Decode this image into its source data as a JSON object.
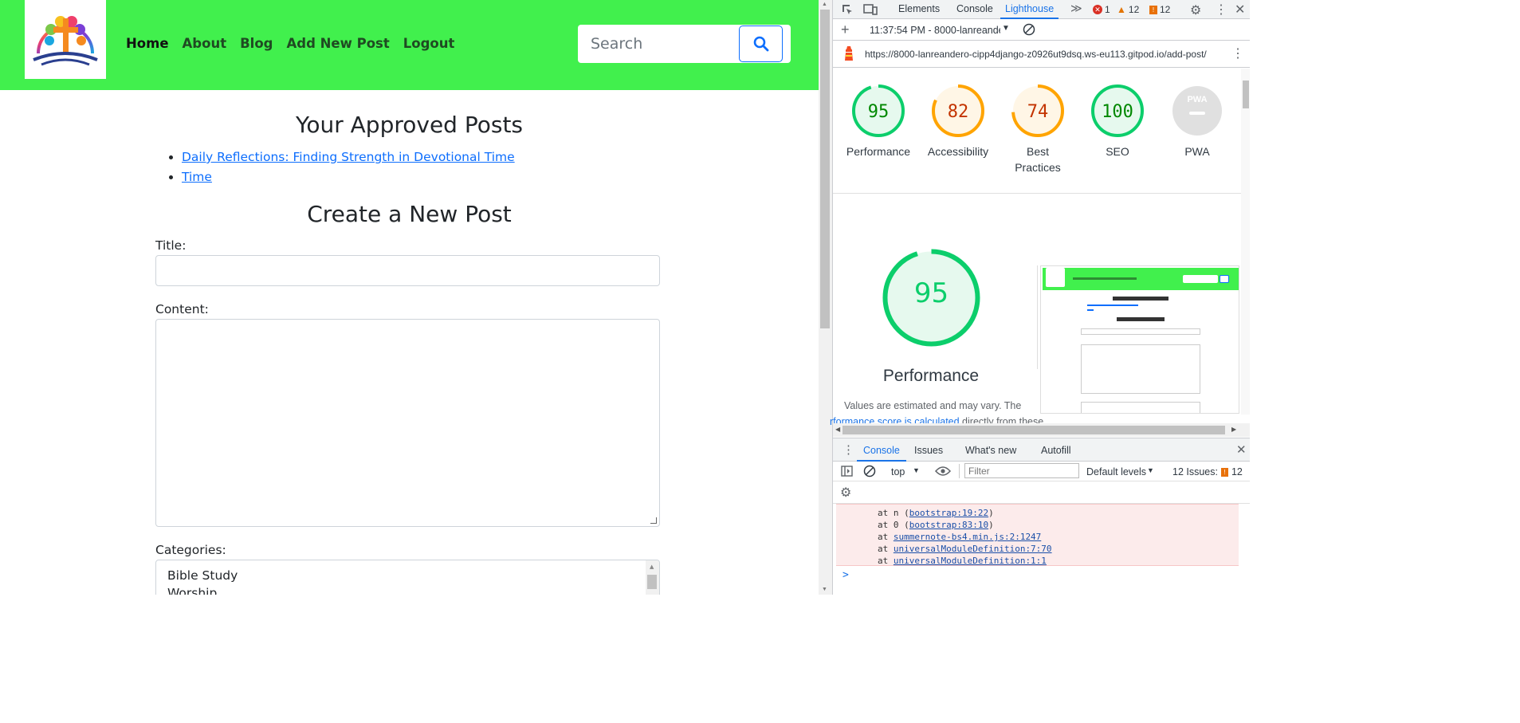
{
  "page": {
    "nav": {
      "links": [
        "Home",
        "About",
        "Blog",
        "Add New Post",
        "Logout"
      ],
      "search_placeholder": "Search"
    },
    "approved": {
      "heading": "Your Approved Posts",
      "posts": [
        "Daily Reflections: Finding Strength in Devotional Time",
        "Time"
      ]
    },
    "form": {
      "heading": "Create a New Post",
      "title_label": "Title:",
      "content_label": "Content:",
      "categories_label": "Categories:",
      "categories": [
        "Bible Study",
        "Worship"
      ]
    }
  },
  "devtools": {
    "tabs": [
      "Elements",
      "Console",
      "Lighthouse"
    ],
    "active_tab": "Lighthouse",
    "badges": {
      "errors": "1",
      "warnings": "12",
      "issues": "12"
    },
    "report_time": "11:37:54 PM - 8000-lanreande",
    "url": "https://8000-lanreandero-cipp4django-z0926ut9dsq.ws-eu113.gitpod.io/add-post/",
    "scores": [
      {
        "label": "Performance",
        "value": 95,
        "color": "#0cce6b",
        "bg": "#e6f9ee",
        "text": "#008800"
      },
      {
        "label": "Accessibility",
        "value": 82,
        "color": "#ffa400",
        "bg": "#fff6e6",
        "text": "#c33300"
      },
      {
        "label": "Best Practices",
        "value": 74,
        "color": "#ffa400",
        "bg": "#fff6e6",
        "text": "#c33300"
      },
      {
        "label": "SEO",
        "value": 100,
        "color": "#0cce6b",
        "bg": "#e6f9ee",
        "text": "#008800"
      },
      {
        "label": "PWA",
        "value": "PWA",
        "color": "#dadada",
        "bg": "#e0e0e0",
        "text": "#999999"
      }
    ],
    "big_score": {
      "value": 95,
      "label": "Performance"
    },
    "note_line1": "Values are estimated and may vary. The",
    "note_link": "rformance score is calculated",
    "note_rest": " directly from these",
    "drawer_tabs": [
      "Console",
      "Issues",
      "What's new",
      "Autofill"
    ],
    "active_drawer": "Console",
    "context": "top",
    "filter_placeholder": "Filter",
    "levels": "Default levels",
    "issues_label": "12 Issues:",
    "issues_count": "12",
    "log": [
      {
        "pre": "at n (",
        "link": "bootstrap:19:22",
        "post": ")"
      },
      {
        "pre": "at 0 (",
        "link": "bootstrap:83:10",
        "post": ")"
      },
      {
        "pre": "at ",
        "link": "summernote-bs4.min.js:2:1247",
        "post": ""
      },
      {
        "pre": "at ",
        "link": "universalModuleDefinition:7:70",
        "post": ""
      },
      {
        "pre": "at ",
        "link": "universalModuleDefinition:1:1",
        "post": ""
      }
    ],
    "prompt": ">"
  }
}
